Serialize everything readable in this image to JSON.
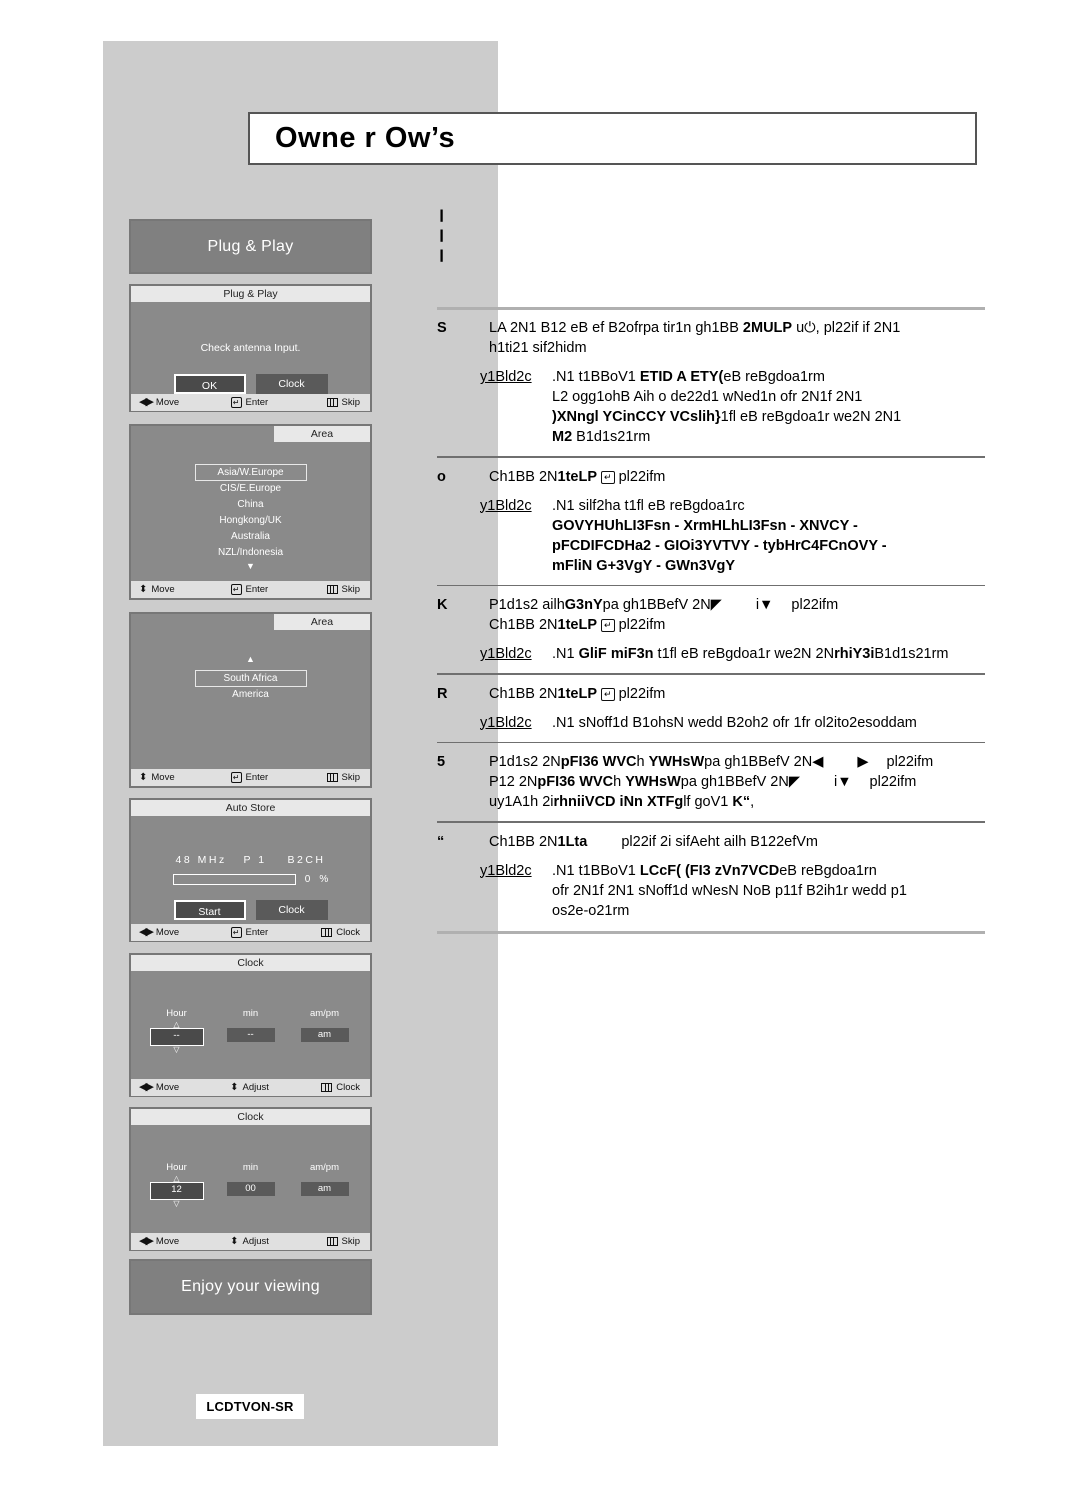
{
  "header": {
    "title": "Owne r Ow’s"
  },
  "sidebar": {
    "model_badge": "LCDTVON-SR",
    "banner_top": "Plug & Play",
    "banner_bottom": "Enjoy your viewing",
    "screens": [
      {
        "name": "plug-play",
        "title": "Plug & Play",
        "message": "Check antenna Input.",
        "buttons": [
          {
            "label": "OK",
            "selected": true
          },
          {
            "label": "Clock",
            "selected": false
          }
        ],
        "footer": [
          {
            "icon": "left-right-arrows-icon",
            "label": "Move"
          },
          {
            "icon": "enter-key-icon",
            "label": "Enter"
          },
          {
            "icon": "menu-key-icon",
            "label": "Skip"
          }
        ]
      },
      {
        "name": "area-1",
        "title": "Area",
        "items": [
          {
            "label": "Asia/W.Europe",
            "selected": true
          },
          {
            "label": "CIS/E.Europe",
            "selected": false
          },
          {
            "label": "China",
            "selected": false
          },
          {
            "label": "Hongkong/UK",
            "selected": false
          },
          {
            "label": "Australia",
            "selected": false
          },
          {
            "label": "NZL/Indonesia",
            "selected": false
          }
        ],
        "scroll_down": "▼",
        "footer": [
          {
            "icon": "up-down-arrows-icon",
            "label": "Move"
          },
          {
            "icon": "enter-key-icon",
            "label": "Enter"
          },
          {
            "icon": "menu-key-icon",
            "label": "Skip"
          }
        ]
      },
      {
        "name": "area-2",
        "title": "Area",
        "scroll_up": "▲",
        "items": [
          {
            "label": "South Africa",
            "selected": true
          },
          {
            "label": "America",
            "selected": false
          }
        ],
        "footer": [
          {
            "icon": "up-down-arrows-icon",
            "label": "Move"
          },
          {
            "icon": "enter-key-icon",
            "label": "Enter"
          },
          {
            "icon": "menu-key-icon",
            "label": "Skip"
          }
        ]
      },
      {
        "name": "auto-store",
        "title": "Auto Store",
        "freq": "48",
        "freq_unit": "MHz",
        "prog_letter": "P",
        "prog_number": "1",
        "channel": "B2CH",
        "progress_value": "0",
        "progress_unit": "%",
        "progress_percent": 0,
        "buttons": [
          {
            "label": "Start",
            "selected": true
          },
          {
            "label": "Clock",
            "selected": false
          }
        ],
        "footer": [
          {
            "icon": "left-right-arrows-icon",
            "label": "Move"
          },
          {
            "icon": "enter-key-icon",
            "label": "Enter"
          },
          {
            "icon": "menu-key-icon",
            "label": "Clock"
          }
        ]
      },
      {
        "name": "clock-empty",
        "title": "Clock",
        "fields": [
          {
            "label": "Hour",
            "value": "--",
            "selected": true
          },
          {
            "label": "min",
            "value": "--",
            "selected": false
          },
          {
            "label": "am/pm",
            "value": "am",
            "selected": false
          }
        ],
        "footer": [
          {
            "icon": "left-right-arrows-icon",
            "label": "Move"
          },
          {
            "icon": "up-down-arrows-icon",
            "label": "Adjust"
          },
          {
            "icon": "menu-key-icon",
            "label": "Clock"
          }
        ]
      },
      {
        "name": "clock-set",
        "title": "Clock",
        "fields": [
          {
            "label": "Hour",
            "value": "12",
            "selected": true
          },
          {
            "label": "min",
            "value": "00",
            "selected": false
          },
          {
            "label": "am/pm",
            "value": "am",
            "selected": false
          }
        ],
        "footer": [
          {
            "icon": "left-right-arrows-icon",
            "label": "Move"
          },
          {
            "icon": "up-down-arrows-icon",
            "label": "Adjust"
          },
          {
            "icon": "menu-key-icon",
            "label": "Skip"
          }
        ]
      }
    ]
  },
  "content": {
    "top_glyphs": [
      "❙",
      "❙",
      "❙"
    ],
    "steps": [
      {
        "marker": "S",
        "lines": [
          "LA 2N1 B12 eB ef B2ofrpa tir1n gh1BB <b>2MULP</b> u⏻, pl22if if 2N1",
          "h1ti21 sif2hidm"
        ],
        "result": {
          "label": "y1Bld2c",
          "lines": [
            ".N1 t1BBoV1 <b>ETID A ETY(</b>eB reBgdoa1rm",
            "L2 ogg1ohB Aih o de22d1 wNed1n ofr 2N1f 2N1",
            "<b>)XNngl YCinCCY VCslih}</b>1fl eB reBgdoa1r we2N 2N1",
            "<b>M2</b> B1d1s21rm"
          ]
        }
      },
      {
        "marker": "o",
        "lines": [
          "Ch1BB 2N<b>1teLP</b> <span class=\"inl-enter\">↵</span> pl22ifm"
        ],
        "result": {
          "label": "y1Bld2c",
          "lines": [
            ".N1 silf2ha t1fl eB reBgdoa1rc",
            "<b>GOVYHUhLI3Fsn - XrmHLhLI3Fsn - XNVCY -</b>",
            "<b>pFCDIFCDHa2 - GIOi3YVTVY - tybHrC4FCnOVY -</b>",
            "<b>mFliN G+3VgY - GWn3VgY</b>"
          ]
        }
      },
      {
        "marker": "K",
        "lines": [
          "P1d1s2 ailh<b>G3nY</b>pa gh1BBefV 2N◤<span class=\"sp-md\"></span>i▼<span class=\"sp-sm\"></span>pl22ifm",
          "Ch1BB 2N<b>1teLP</b> <span class=\"inl-enter\">↵</span> pl22ifm"
        ],
        "result": {
          "label": "y1Bld2c",
          "lines": [
            ".N1 <b>GliF miF3n</b> t1fl eB reBgdoa1r we2N 2N<b>rhiY3i</b>B1d1s21rm"
          ]
        }
      },
      {
        "marker": "R",
        "lines": [
          "Ch1BB 2N<b>1teLP</b> <span class=\"inl-enter\">↵</span> pl22ifm"
        ],
        "result": {
          "label": "y1Bld2c",
          "lines": [
            ".N1 sNoff1d B1ohsN wedd B2oh2 ofr 1fr ol2ito2esoddam"
          ]
        }
      },
      {
        "marker": "5",
        "lines": [
          "P1d1s2 2N<b>pFI36 WVC</b>h <b>YWHsW</b>pa gh1BBefV 2N◀<span class=\"sp-md\"></span>▶<span class=\"sp-sm\"></span>pl22ifm",
          "P12 2N<b>pFI36 WVC</b>h <b>YWHsW</b>pa gh1BBefV 2N◤<span class=\"sp-md\"></span>i▼<span class=\"sp-sm\"></span>pl22ifm",
          "uy1A1h 2i<b>rhniiVCD iNn XTFg</b>lf goV1 <b>K“</b>,"
        ],
        "result": null
      },
      {
        "marker": "“",
        "lines": [
          "Ch1BB 2N<b>1Lta</b><span class=\"sp-md\"></span>pl22if 2i sifAeht ailh B122efVm"
        ],
        "result": {
          "label": "y1Bld2c",
          "lines": [
            ".N1 t1BBoV1 <b>LCcF( (FI3 zVn7VCD</b>eB reBgdoa1rn",
            "ofr 2N1f 2N1 sNoff1d wNesN NoB p11f B2ih1r wedd p1",
            "os2e-o21rm"
          ]
        }
      }
    ]
  },
  "colors": {
    "sidebar_bg": "#cccccc",
    "osd_bg": "#8a8a8a",
    "osd_title_bg": "#e8e8e8",
    "osd_footer_bg": "#e0e0e0",
    "banner_bg": "#808080",
    "rule": "#b0b0b0"
  }
}
